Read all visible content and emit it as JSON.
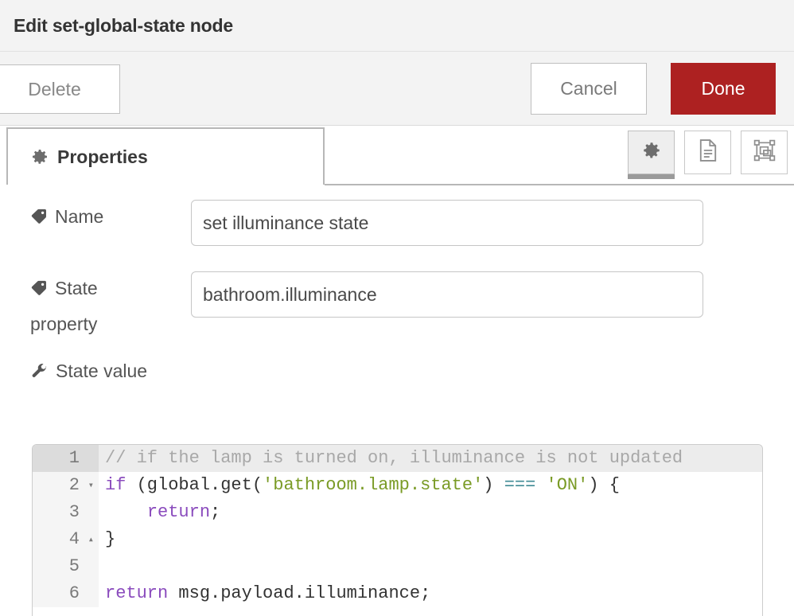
{
  "header": {
    "title": "Edit set-global-state node"
  },
  "toolbar": {
    "delete_label": "Delete",
    "cancel_label": "Cancel",
    "done_label": "Done",
    "done_color": "#ad2121"
  },
  "tabs": [
    {
      "label": "Properties",
      "icon": "gear-icon",
      "active": true
    }
  ],
  "icon_buttons": [
    {
      "name": "properties-icon-button",
      "icon": "gear-icon",
      "active": true
    },
    {
      "name": "description-icon-button",
      "icon": "document-icon",
      "active": false
    },
    {
      "name": "appearance-icon-button",
      "icon": "layout-icon",
      "active": false
    }
  ],
  "form": {
    "name": {
      "label": "Name",
      "icon": "tag-icon",
      "value": "set illuminance state",
      "placeholder": "Name"
    },
    "state_property": {
      "label": "State property",
      "icon": "tag-icon",
      "value": "bathroom.illuminance",
      "placeholder": "State property"
    },
    "state_value": {
      "label": "State value",
      "icon": "wrench-icon"
    }
  },
  "editor": {
    "lines": [
      {
        "number": "1",
        "fold": "",
        "active": true,
        "tokens": [
          {
            "type": "comment",
            "text": "// if the lamp is turned on, illuminance is not updated"
          }
        ]
      },
      {
        "number": "2",
        "fold": "▾",
        "active": false,
        "tokens": [
          {
            "type": "keyword",
            "text": "if"
          },
          {
            "type": "plain",
            "text": " (global.get("
          },
          {
            "type": "string",
            "text": "'bathroom.lamp.state'"
          },
          {
            "type": "plain",
            "text": ") "
          },
          {
            "type": "operator",
            "text": "==="
          },
          {
            "type": "plain",
            "text": " "
          },
          {
            "type": "string",
            "text": "'ON'"
          },
          {
            "type": "plain",
            "text": ") {"
          }
        ]
      },
      {
        "number": "3",
        "fold": "",
        "active": false,
        "tokens": [
          {
            "type": "plain",
            "text": "    "
          },
          {
            "type": "keyword",
            "text": "return"
          },
          {
            "type": "plain",
            "text": ";"
          }
        ]
      },
      {
        "number": "4",
        "fold": "▴",
        "active": false,
        "tokens": [
          {
            "type": "plain",
            "text": "}"
          }
        ]
      },
      {
        "number": "5",
        "fold": "",
        "active": false,
        "tokens": []
      },
      {
        "number": "6",
        "fold": "",
        "active": false,
        "tokens": [
          {
            "type": "keyword",
            "text": "return"
          },
          {
            "type": "plain",
            "text": " msg.payload.illuminance;"
          }
        ]
      }
    ],
    "colors": {
      "comment": "#a8a8a8",
      "keyword": "#8a4bbd",
      "string": "#7a9b26",
      "operator": "#3f8a94",
      "plain": "#333333"
    }
  }
}
